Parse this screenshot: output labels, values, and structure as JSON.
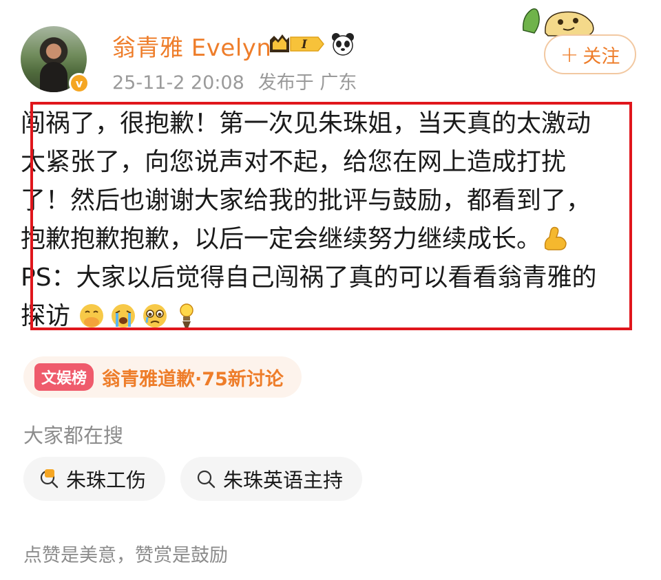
{
  "author": {
    "name": "翁青雅 Evelyn",
    "avatar_icon": "user-avatar",
    "verified_icon": "verified-v-badge",
    "verified_letter": "v",
    "level_badge_letter": "I",
    "timestamp": "25-11-2 20:08",
    "location": "发布于 广东"
  },
  "follow_button": {
    "plus": "+",
    "label": "关注"
  },
  "post": {
    "lines": [
      "闯祸了，很抱歉！第一次见朱珠姐，当天真的太激动",
      "太紧张了，向您说声对不起，给您在网上造成打扰",
      "了！然后也谢谢大家给我的批评与鼓励，都看到了，",
      "抱歉抱歉抱歉，以后一定会继续努力继续成长。",
      "PS：大家以后觉得自己闯祸了真的可以看看翁青雅的",
      "探访"
    ],
    "line4_emoji": "flexed-biceps-emoji",
    "line6_emojis": [
      "hand-over-mouth-emoji",
      "loudly-crying-emoji",
      "pleading-tears-emoji",
      "idea-bulb-emoji"
    ]
  },
  "topic": {
    "tag": "文娱榜",
    "text": "翁青雅道歉·75新讨论"
  },
  "search_section": {
    "label": "大家都在搜",
    "chips": [
      {
        "icon": "hot-search-icon",
        "text": "朱珠工伤"
      },
      {
        "icon": "search-icon",
        "text": "朱珠英语主持"
      }
    ]
  },
  "footer_text": "点赞是美意，赞赏是鼓励",
  "colors": {
    "accent": "#ee7d2a",
    "highlight_border": "#e0161c",
    "topic_tag": "#ef5b6c"
  }
}
